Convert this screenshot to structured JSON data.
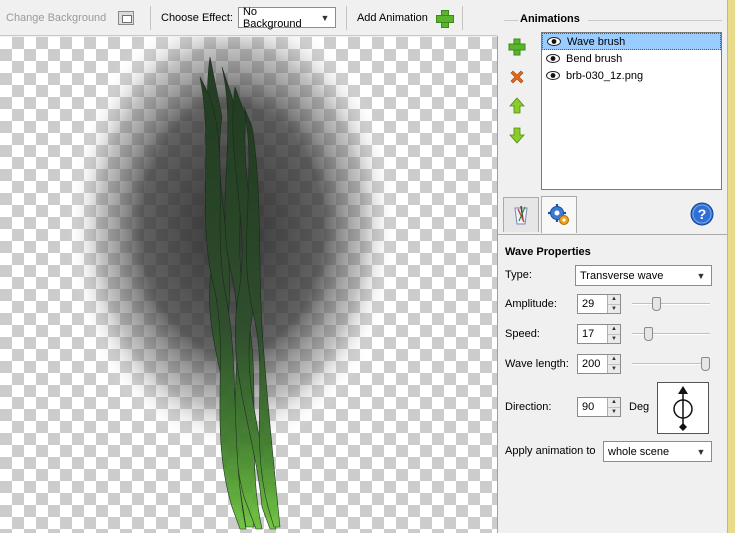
{
  "toolbar": {
    "change_background": "Change Background",
    "choose_effect_label": "Choose Effect:",
    "effect_value": "No Background",
    "add_animation": "Add Animation"
  },
  "animations": {
    "title": "Animations",
    "items": [
      {
        "label": "Wave brush",
        "selected": true
      },
      {
        "label": "Bend brush",
        "selected": false
      },
      {
        "label": "brb-030_1z.png",
        "selected": false
      }
    ]
  },
  "wave": {
    "title": "Wave Properties",
    "type_label": "Type:",
    "type_value": "Transverse wave",
    "amplitude_label": "Amplitude:",
    "amplitude": "29",
    "amplitude_level": 0.29,
    "speed_label": "Speed:",
    "speed": "17",
    "speed_level": 0.17,
    "wavelength_label": "Wave length:",
    "wavelength": "200",
    "wavelength_level": 1.0,
    "direction_label": "Direction:",
    "direction": "90",
    "direction_unit": "Deg",
    "apply_label": "Apply animation to",
    "apply_value": "whole scene"
  },
  "colors": {
    "selection": "#99ccff",
    "add_green": "#5ab52d",
    "delete_orange": "#e06a1c",
    "help_blue": "#2f6fd6"
  }
}
